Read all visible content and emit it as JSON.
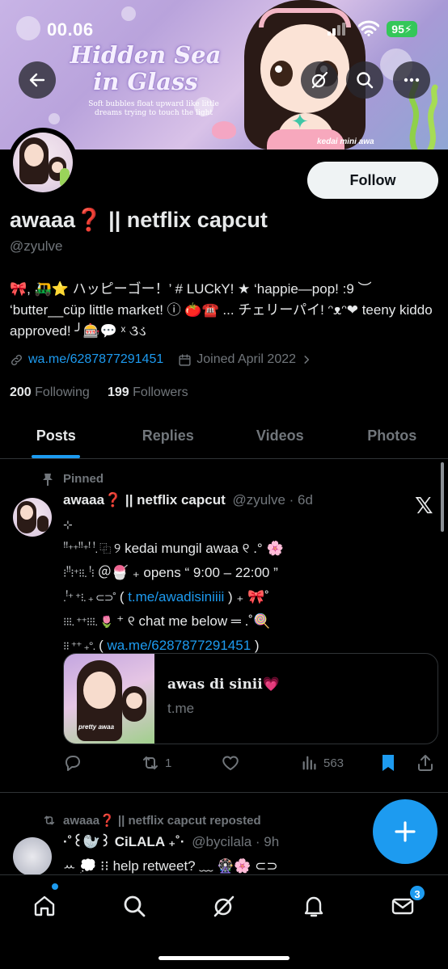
{
  "status": {
    "time": "00.06",
    "battery": "95"
  },
  "banner": {
    "title_line1": "Hidden Sea",
    "title_line2": "in Glass",
    "subtitle": "Soft bubbles float upward like little dreams trying to touch the light",
    "tag": "kedai mini awa"
  },
  "header_icons": [
    "back-arrow-icon",
    "grok-icon",
    "search-icon",
    "more-icon"
  ],
  "profile": {
    "follow_label": "Follow",
    "display_name": "awaaa❓ || netflix capcut",
    "handle": "@zyulve",
    "bio": "🎀, 🛺⭐ ハッピーゴー！’ # LUCkY! ★ ‘happie—pop! :9 ︶ ‘butter__cüp little market! ⓘ 🍅☎️ ... チェリーパイ! ᵔᴥᵔ❤ teeny kiddo approved! ╯🎰💬 ˣ ૩ડ",
    "link": "wa.me/6287877291451",
    "joined": "Joined April 2022",
    "following_count": "200",
    "following_label": "Following",
    "followers_count": "199",
    "followers_label": "Followers"
  },
  "tabs": [
    {
      "label": "Posts",
      "active": true
    },
    {
      "label": "Replies",
      "active": false
    },
    {
      "label": "Videos",
      "active": false
    },
    {
      "label": "Photos",
      "active": false
    }
  ],
  "pinned_tweet": {
    "pinned_label": "Pinned",
    "name": "awaaa❓ || netflix capcut",
    "handle": "@zyulve · 6d",
    "lines": [
      {
        "prefix": "⊹",
        "text": "",
        "link": "",
        "suffix": ""
      },
      {
        "prefix": "ꜝꜝ⁺⁺ꜝꜝ⁺ꜝ ꜝ. ⿻",
        "text": " ୨ kedai mungil awaa ୧ .° 🌸",
        "link": "",
        "suffix": ""
      },
      {
        "prefix": "⁝ꜝꜝ⁝⁺⁝⁝. ꜝ⁝",
        "text": " ＠🍧 ₊ opens “ 9:00 – 22:00 ”",
        "link": "",
        "suffix": ""
      },
      {
        "prefix": ".ꜝ⁺ ⁺⁝. ₊ ⊂⊃˚",
        "text": " ( ",
        "link": "t.me/awadisiniiii",
        "suffix": " ) ₊ 🎀˚"
      },
      {
        "prefix": "⁝⁝⁝. ⁺⁺⁝⁝⁝. 🌷",
        "text": " ⁺ ୧ chat me below ═ .˚🍭",
        "link": "",
        "suffix": ""
      },
      {
        "prefix": "⁝⁝ ⁺⁺ ₊°.",
        "text": " ( ",
        "link": "wa.me/6287877291451",
        "suffix": " )"
      }
    ],
    "card_title": "awas di sinii💗",
    "card_domain": "t.me",
    "card_image_text": "pretty awaa",
    "retweets": "1",
    "views": "563"
  },
  "repost": {
    "label": "awaaa❓ || netflix capcut reposted",
    "name": "·˚꒰🦭꒱ CiLALA ₊˚·",
    "handle": "@bycilala · 9h",
    "text": "ꕀ 💭 ⁝⁝ help retweet? ﹏ 🎡🌸 ⊂⊃"
  },
  "nav": {
    "messages_badge": "3",
    "items": [
      "home-icon",
      "search-icon",
      "grok-icon",
      "notifications-icon",
      "messages-icon"
    ]
  },
  "colors": {
    "accent": "#1d9bf0",
    "background": "#000000",
    "text": "#e7e9ea",
    "muted": "#71767b"
  }
}
